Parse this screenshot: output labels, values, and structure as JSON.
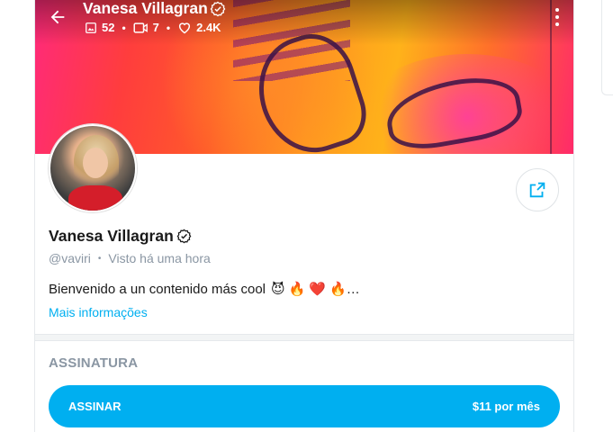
{
  "cover": {
    "display_name": "Vanesa Villagran",
    "stats": [
      {
        "icon": "image-icon",
        "value": "52"
      },
      {
        "icon": "video-icon",
        "value": "7"
      },
      {
        "icon": "heart-icon",
        "value": "2.4K"
      }
    ]
  },
  "profile": {
    "name": "Vanesa Villagran",
    "username": "@vaviri",
    "last_seen": "Visto há uma hora",
    "bio_text": "Bienvenido a un contenido más cool",
    "bio_emojis": [
      "😈",
      "🔥",
      "❤️",
      "🔥"
    ],
    "bio_ellipsis": "…",
    "more_info_label": "Mais informações"
  },
  "subscription": {
    "section_title": "ASSINATURA",
    "button_label": "ASSINAR",
    "price_label": "$11 por mês"
  },
  "colors": {
    "accent": "#00aff0",
    "muted_text": "#8a96a3",
    "verified": "#ffffff"
  }
}
